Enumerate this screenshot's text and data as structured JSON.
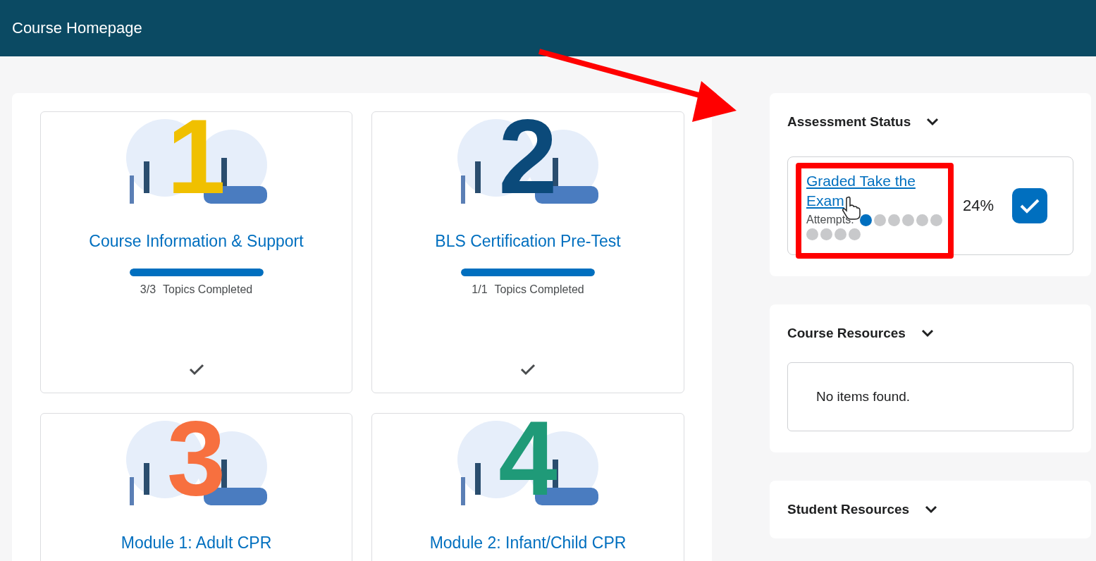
{
  "header": {
    "title": "Course Homepage"
  },
  "modules": [
    {
      "numeral": "1",
      "color": "#f0c000",
      "title": "Course Information & Support",
      "level": 1,
      "count": "3/3",
      "progress_label": "Topics Completed",
      "completed": true
    },
    {
      "numeral": "2",
      "color": "#0b4a7a",
      "title": "BLS Certification Pre-Test",
      "level": 1,
      "count": "1/1",
      "progress_label": "Topics Completed",
      "completed": true
    },
    {
      "numeral": "3",
      "color": "#f7703f",
      "title": "Module 1: Adult CPR"
    },
    {
      "numeral": "4",
      "color": "#1f9a78",
      "title": "Module 2: Infant/Child CPR"
    }
  ],
  "widgets": [
    {
      "kind": "assessment",
      "title": "Assessment Status",
      "item": {
        "link": "Graded Take the Exam",
        "attempts_label": "Attempts:",
        "attempts": [
          {
            "used": true
          },
          {
            "used": false
          },
          {
            "used": false
          },
          {
            "used": false
          },
          {
            "used": false
          },
          {
            "used": false
          },
          {
            "used": false
          },
          {
            "used": false
          },
          {
            "used": false
          },
          {
            "used": false
          }
        ],
        "score": "24%",
        "checked": true
      }
    },
    {
      "kind": "empty",
      "title": "Course Resources",
      "message": "No items found."
    },
    {
      "kind": "collapsed",
      "title": "Student Resources"
    }
  ]
}
